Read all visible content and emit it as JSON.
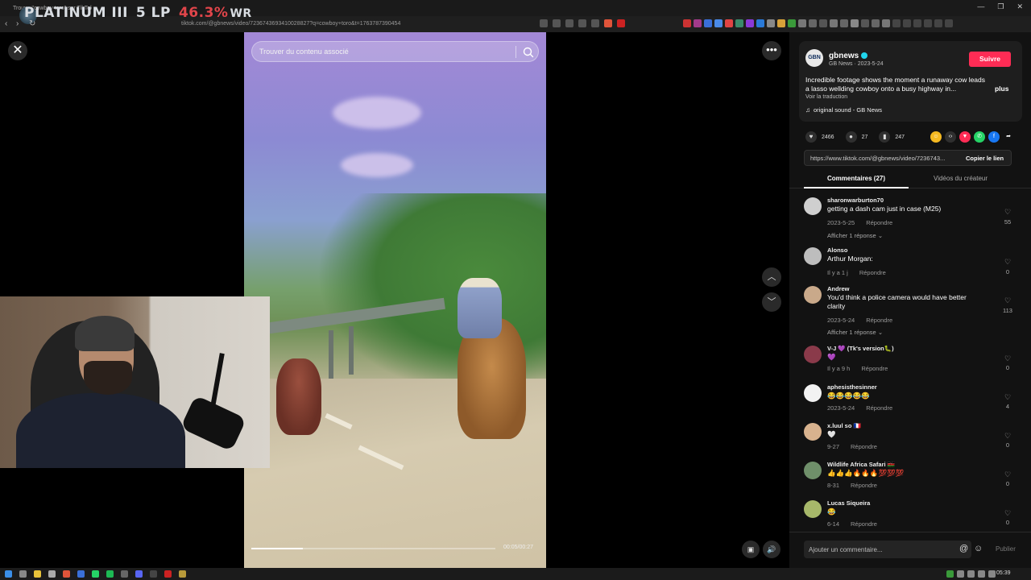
{
  "browser": {
    "tab_title": "Trouve \"cowboy toro\" sur TikTok",
    "url": "tiktok.com/@gbnews/video/7236743693410028827?q=cowboy+toro&t=1763787390454"
  },
  "stream_overlay": {
    "tier": "PLATINUM III",
    "lp": "5 LP",
    "winrate_value": "46.3%",
    "winrate_label": "WR"
  },
  "player": {
    "search_placeholder": "Trouver du contenu associé",
    "time": "00:05/00:27",
    "progress": 0.21
  },
  "post": {
    "author": "gbnews",
    "author_sub": "GB News · 2023-5-24",
    "avatar_text": "GBN",
    "follow_label": "Suivre",
    "description": "Incredible footage shows the moment a runaway cow leads a lasso wellding cowboy onto a busy highway in...",
    "more_label": "plus",
    "translate_label": "Voir la traduction",
    "sound": "original sound - GB News",
    "likes": "2466",
    "comments_count": "27",
    "saves": "247",
    "link": "https://www.tiktok.com/@gbnews/video/7236743...",
    "copy_label": "Copier le lien"
  },
  "tabs": {
    "comments": "Commentaires (27)",
    "creator": "Vidéos du créateur"
  },
  "comments": [
    {
      "user": "sharonwarburton70",
      "text": "getting a dash cam just in case (M25)",
      "date": "2023-5-25",
      "reply": "Répondre",
      "likes": "55",
      "replies": "Afficher 1 réponse ⌄",
      "avatar": "#cfcfcf"
    },
    {
      "user": "Alonso",
      "text": "Arthur Morgan:",
      "date": "Il y a 1 j",
      "reply": "Répondre",
      "likes": "0",
      "replies": "",
      "avatar": "#bdbdbd"
    },
    {
      "user": "Andrew",
      "text": "You'd think a police camera would have better clarity",
      "date": "2023-5-24",
      "reply": "Répondre",
      "likes": "113",
      "replies": "Afficher 1 réponse ⌄",
      "avatar": "#c9a98a"
    },
    {
      "user": "V-J 💜 (Tk's version🐛)",
      "text": "💜",
      "date": "Il y a 9 h",
      "reply": "Répondre",
      "likes": "0",
      "replies": "",
      "avatar": "#8a3a4a"
    },
    {
      "user": "aphesisthesinner",
      "text": "😂😂😂😂😂",
      "date": "2023-5-24",
      "reply": "Répondre",
      "likes": "4",
      "replies": "",
      "avatar": "#f2f2f2"
    },
    {
      "user": "x.luul so 🇫🇷",
      "text": "🤍",
      "date": "9-27",
      "reply": "Répondre",
      "likes": "0",
      "replies": "",
      "avatar": "#d8b28e"
    },
    {
      "user": "Wildlife Africa Safari 🇰🇪",
      "text": "👍👍👍🔥🔥🔥💯💯💯",
      "date": "8-31",
      "reply": "Répondre",
      "likes": "0",
      "replies": "",
      "avatar": "#6f8f6a"
    },
    {
      "user": "Lucas Siqueira",
      "text": "😂",
      "date": "6-14",
      "reply": "Répondre",
      "likes": "0",
      "replies": "",
      "avatar": "#a7b86a"
    }
  ],
  "comment_bar": {
    "placeholder": "Ajouter un commentaire...",
    "publish": "Publier"
  },
  "taskbar": {
    "clock": "05:39"
  },
  "icons": {
    "close": "close-icon",
    "more": "more-icon",
    "up": "chevron-up-icon",
    "down": "chevron-down-icon",
    "search": "search-icon",
    "heart": "heart-icon",
    "comment": "comment-icon",
    "bookmark": "bookmark-icon",
    "sound": "music-note-icon",
    "volume": "volume-icon",
    "mini": "miniplayer-icon"
  },
  "colors": {
    "accent": "#fe2c55",
    "verified": "#20d5ec",
    "winrate": "#e0454a"
  }
}
